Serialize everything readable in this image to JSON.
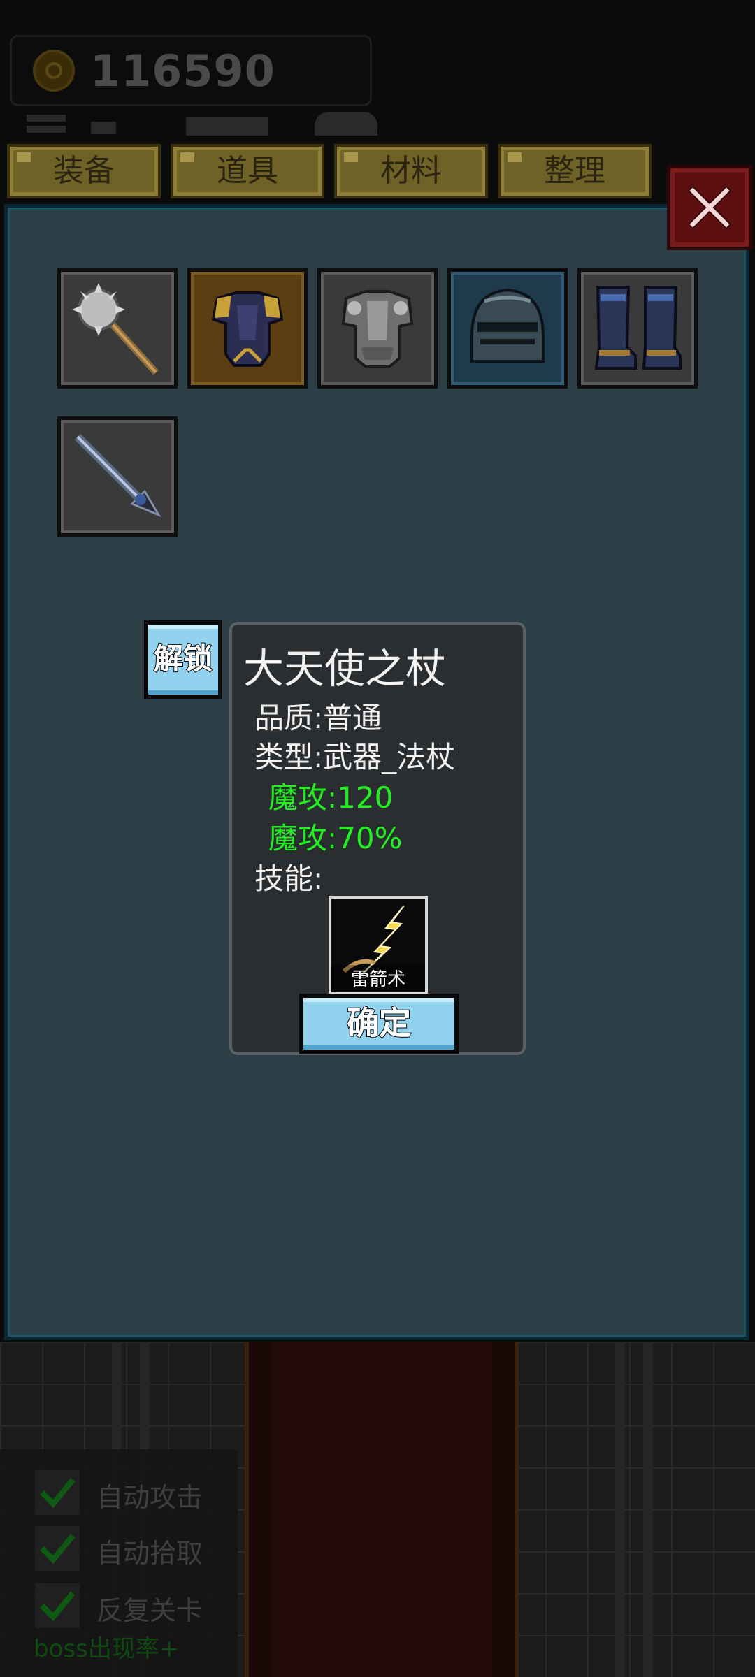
{
  "currency": {
    "coins": "116590",
    "icon": "gold-coin-icon"
  },
  "tabs": [
    {
      "label": "装备"
    },
    {
      "label": "道具"
    },
    {
      "label": "材料"
    },
    {
      "label": "整理"
    }
  ],
  "close": {
    "icon": "close-x-icon"
  },
  "inventory": {
    "slots": [
      {
        "item": "spiked-mace-icon",
        "frame": "gray"
      },
      {
        "item": "gold-trim-armor-icon",
        "frame": "gold"
      },
      {
        "item": "steel-armor-icon",
        "frame": "gray"
      },
      {
        "item": "knight-helmet-icon",
        "frame": "blue"
      },
      {
        "item": "iron-boots-icon",
        "frame": "gray"
      },
      {
        "item": "staff-icon",
        "frame": "gray"
      }
    ]
  },
  "unlock_button": {
    "label": "解锁"
  },
  "item_tooltip": {
    "name": "大天使之杖",
    "quality": "品质:普通",
    "type": "类型:武器_法杖",
    "stats": [
      "魔攻:120",
      "魔攻:70%"
    ],
    "skills_label": "技能:",
    "skill": {
      "name": "雷箭术",
      "icon": "lightning-arrow-icon"
    },
    "confirm_label": "确定",
    "stat_color": "#22ee22"
  },
  "options": {
    "items": [
      {
        "label": "自动攻击",
        "checked": true
      },
      {
        "label": "自动拾取",
        "checked": true
      },
      {
        "label": "反复关卡",
        "checked": true
      }
    ],
    "boss_rate": "boss出现率+"
  }
}
